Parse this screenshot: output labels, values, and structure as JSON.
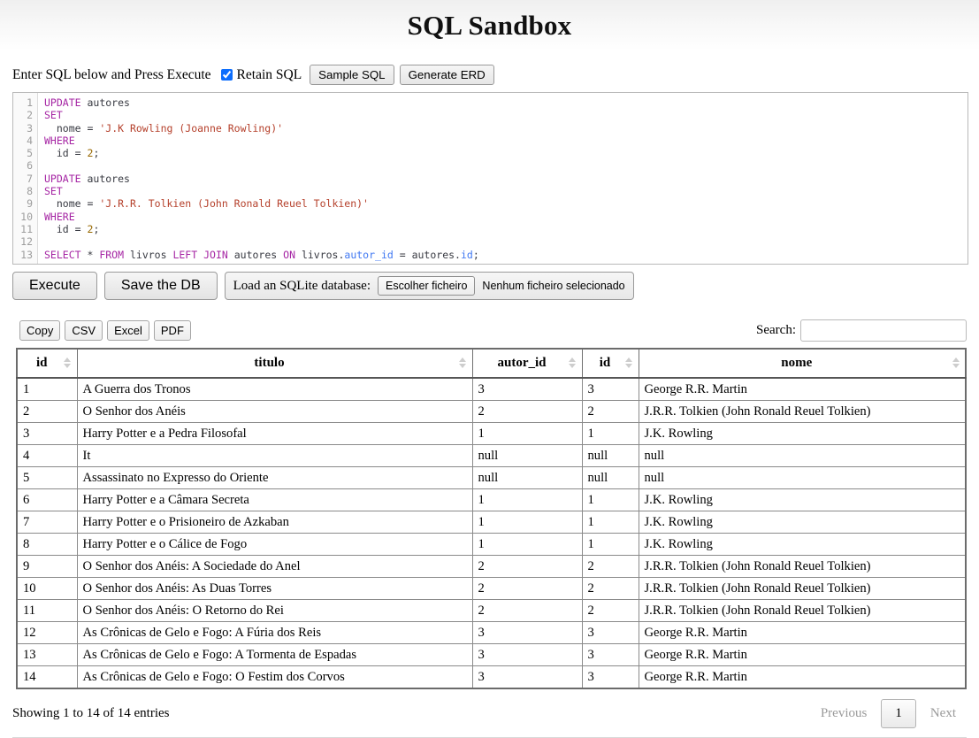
{
  "app": {
    "title": "SQL Sandbox"
  },
  "toolbar": {
    "hint": "Enter SQL below and Press Execute",
    "retain_sql_label": "Retain SQL",
    "retain_sql_checked": true,
    "sample_sql_label": "Sample SQL",
    "generate_erd_label": "Generate ERD"
  },
  "editor": {
    "line_numbers": [
      "1",
      "2",
      "3",
      "4",
      "5",
      "6",
      "7",
      "8",
      "9",
      "10",
      "11",
      "12",
      "13"
    ],
    "lines": [
      [
        {
          "t": "UPDATE",
          "c": "kw"
        },
        {
          "t": " ",
          "c": "op"
        },
        {
          "t": "autores",
          "c": "id"
        }
      ],
      [
        {
          "t": "SET",
          "c": "kw"
        }
      ],
      [
        {
          "t": "  ",
          "c": "op"
        },
        {
          "t": "nome",
          "c": "id"
        },
        {
          "t": " = ",
          "c": "op"
        },
        {
          "t": "'J.K Rowling (Joanne Rowling)'",
          "c": "str"
        }
      ],
      [
        {
          "t": "WHERE",
          "c": "kw"
        }
      ],
      [
        {
          "t": "  ",
          "c": "op"
        },
        {
          "t": "id",
          "c": "id"
        },
        {
          "t": " = ",
          "c": "op"
        },
        {
          "t": "2",
          "c": "num"
        },
        {
          "t": ";",
          "c": "op"
        }
      ],
      [],
      [
        {
          "t": "UPDATE",
          "c": "kw"
        },
        {
          "t": " ",
          "c": "op"
        },
        {
          "t": "autores",
          "c": "id"
        }
      ],
      [
        {
          "t": "SET",
          "c": "kw"
        }
      ],
      [
        {
          "t": "  ",
          "c": "op"
        },
        {
          "t": "nome",
          "c": "id"
        },
        {
          "t": " = ",
          "c": "op"
        },
        {
          "t": "'J.R.R. Tolkien (John Ronald Reuel Tolkien)'",
          "c": "str"
        }
      ],
      [
        {
          "t": "WHERE",
          "c": "kw"
        }
      ],
      [
        {
          "t": "  ",
          "c": "op"
        },
        {
          "t": "id",
          "c": "id"
        },
        {
          "t": " = ",
          "c": "op"
        },
        {
          "t": "2",
          "c": "num"
        },
        {
          "t": ";",
          "c": "op"
        }
      ],
      [],
      [
        {
          "t": "SELECT",
          "c": "kw"
        },
        {
          "t": " * ",
          "c": "op"
        },
        {
          "t": "FROM",
          "c": "kw"
        },
        {
          "t": " ",
          "c": "op"
        },
        {
          "t": "livros",
          "c": "id"
        },
        {
          "t": " ",
          "c": "op"
        },
        {
          "t": "LEFT",
          "c": "kw"
        },
        {
          "t": " ",
          "c": "op"
        },
        {
          "t": "JOIN",
          "c": "kw"
        },
        {
          "t": " ",
          "c": "op"
        },
        {
          "t": "autores",
          "c": "id"
        },
        {
          "t": " ",
          "c": "op"
        },
        {
          "t": "ON",
          "c": "kw"
        },
        {
          "t": " ",
          "c": "op"
        },
        {
          "t": "livros.",
          "c": "id"
        },
        {
          "t": "autor_id",
          "c": "prop"
        },
        {
          "t": " = ",
          "c": "op"
        },
        {
          "t": "autores.",
          "c": "id"
        },
        {
          "t": "id",
          "c": "prop"
        },
        {
          "t": ";",
          "c": "op"
        }
      ]
    ]
  },
  "actions": {
    "execute_label": "Execute",
    "save_db_label": "Save the DB",
    "load_db_label": "Load an SQLite database:",
    "choose_file_label": "Escolher ficheiro",
    "no_file_label": "Nenhum ficheiro selecionado"
  },
  "datatable": {
    "export_buttons": [
      "Copy",
      "CSV",
      "Excel",
      "PDF"
    ],
    "search_label": "Search:",
    "search_value": "",
    "search_placeholder": "",
    "columns": [
      "id",
      "titulo",
      "autor_id",
      "id",
      "nome"
    ],
    "rows": [
      [
        "1",
        "A Guerra dos Tronos",
        "3",
        "3",
        "George R.R. Martin"
      ],
      [
        "2",
        "O Senhor dos Anéis",
        "2",
        "2",
        "J.R.R. Tolkien (John Ronald Reuel Tolkien)"
      ],
      [
        "3",
        "Harry Potter e a Pedra Filosofal",
        "1",
        "1",
        "J.K. Rowling"
      ],
      [
        "4",
        "It",
        "null",
        "null",
        "null"
      ],
      [
        "5",
        "Assassinato no Expresso do Oriente",
        "null",
        "null",
        "null"
      ],
      [
        "6",
        "Harry Potter e a Câmara Secreta",
        "1",
        "1",
        "J.K. Rowling"
      ],
      [
        "7",
        "Harry Potter e o Prisioneiro de Azkaban",
        "1",
        "1",
        "J.K. Rowling"
      ],
      [
        "8",
        "Harry Potter e o Cálice de Fogo",
        "1",
        "1",
        "J.K. Rowling"
      ],
      [
        "9",
        "O Senhor dos Anéis: A Sociedade do Anel",
        "2",
        "2",
        "J.R.R. Tolkien (John Ronald Reuel Tolkien)"
      ],
      [
        "10",
        "O Senhor dos Anéis: As Duas Torres",
        "2",
        "2",
        "J.R.R. Tolkien (John Ronald Reuel Tolkien)"
      ],
      [
        "11",
        "O Senhor dos Anéis: O Retorno do Rei",
        "2",
        "2",
        "J.R.R. Tolkien (John Ronald Reuel Tolkien)"
      ],
      [
        "12",
        "As Crônicas de Gelo e Fogo: A Fúria dos Reis",
        "3",
        "3",
        "George R.R. Martin"
      ],
      [
        "13",
        "As Crônicas de Gelo e Fogo: A Tormenta de Espadas",
        "3",
        "3",
        "George R.R. Martin"
      ],
      [
        "14",
        "As Crônicas de Gelo e Fogo: O Festim dos Corvos",
        "3",
        "3",
        "George R.R. Martin"
      ]
    ],
    "info": "Showing 1 to 14 of 14 entries",
    "paging": {
      "previous_label": "Previous",
      "current_page": "1",
      "next_label": "Next"
    }
  },
  "colors": {
    "accent": "#0d6efd",
    "keyword": "#a626a4",
    "string": "#b5402b",
    "number": "#986801",
    "property": "#4078f2"
  }
}
